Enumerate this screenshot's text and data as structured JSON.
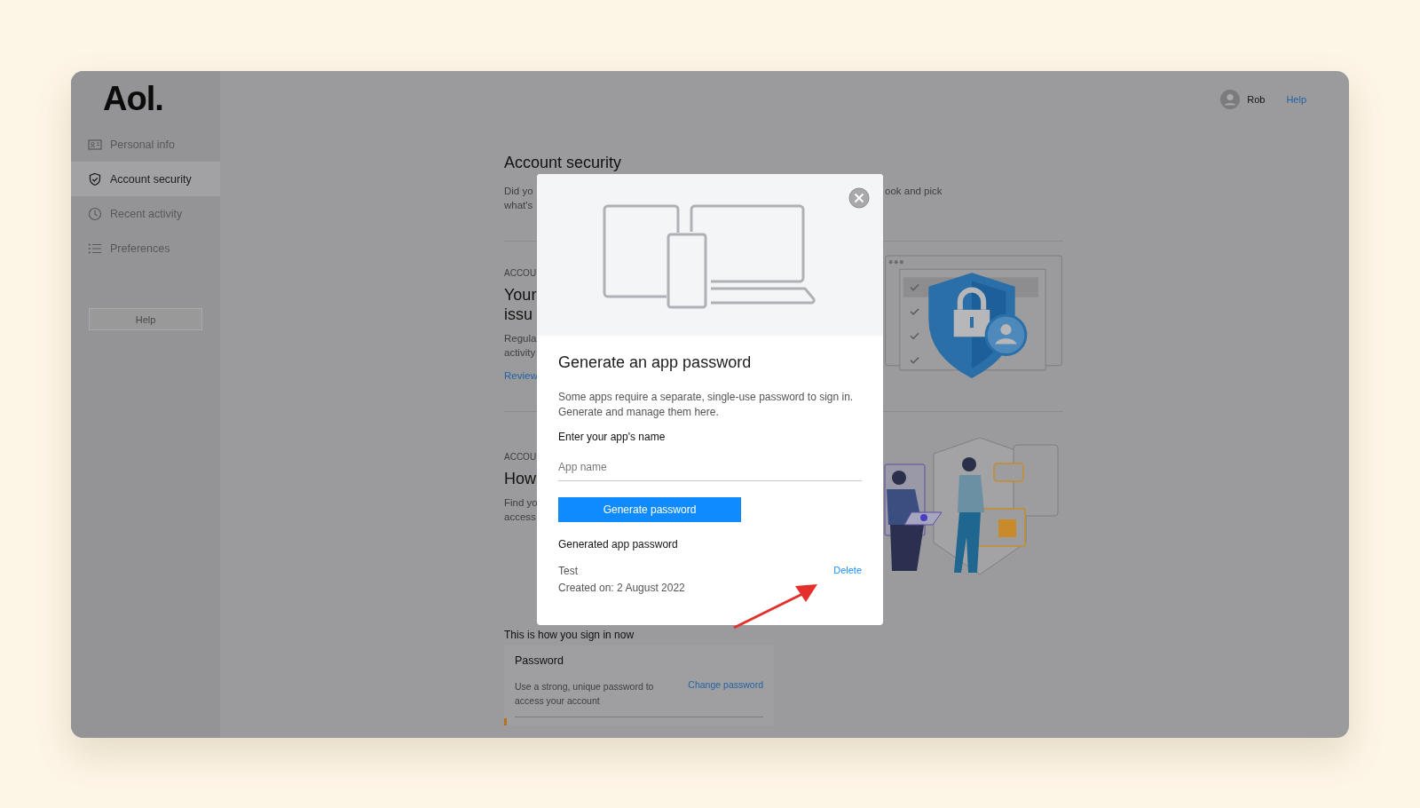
{
  "logo": "Aol.",
  "sidebar": {
    "items": [
      {
        "label": "Personal info",
        "selected": false
      },
      {
        "label": "Account security",
        "selected": true
      },
      {
        "label": "Recent activity",
        "selected": false
      },
      {
        "label": "Preferences",
        "selected": false
      }
    ],
    "help_button": "Help"
  },
  "header": {
    "user": "Rob",
    "help": "Help"
  },
  "page": {
    "title": "Account security",
    "intro_left": [
      "Did yo",
      "what's"
    ],
    "intro_right": "ook and pick",
    "sections": [
      {
        "eyebrow": "ACCOU",
        "title": [
          "Your",
          "issu"
        ],
        "text": [
          "Regula",
          "activity"
        ],
        "link": "Review"
      },
      {
        "eyebrow": "ACCOU",
        "title": [
          "How"
        ],
        "text": [
          "Find yo",
          "access"
        ]
      }
    ],
    "sign_in_heading": "This is how you sign in now",
    "password_card": {
      "title": "Password",
      "description": "Use a strong, unique password to access your account",
      "link": "Change password"
    }
  },
  "modal": {
    "title": "Generate an app password",
    "description": "Some apps require a separate, single-use password to sign in. Generate and manage them here.",
    "field_label": "Enter your app's name",
    "placeholder": "App name",
    "button": "Generate password",
    "generated_heading": "Generated app password",
    "passwords": [
      {
        "name": "Test",
        "created": "Created on: 2 August 2022",
        "action": "Delete"
      }
    ]
  }
}
